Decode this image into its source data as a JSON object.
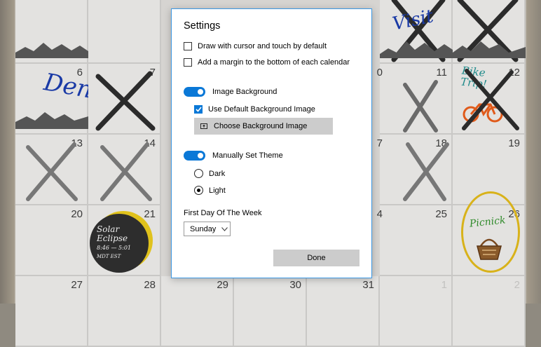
{
  "calendar": {
    "days": [
      {
        "num": "6"
      },
      {
        "num": "7"
      },
      {
        "num": "0"
      },
      {
        "num": "11"
      },
      {
        "num": "12"
      },
      {
        "num": "13"
      },
      {
        "num": "14"
      },
      {
        "num": "7"
      },
      {
        "num": "18"
      },
      {
        "num": "19"
      },
      {
        "num": "20"
      },
      {
        "num": "21"
      },
      {
        "num": "4"
      },
      {
        "num": "25"
      },
      {
        "num": "26"
      },
      {
        "num": "27"
      },
      {
        "num": "28"
      },
      {
        "num": "29"
      },
      {
        "num": "30"
      },
      {
        "num": "31"
      },
      {
        "num": "1"
      },
      {
        "num": "2"
      }
    ],
    "notes": {
      "denver": "Denver!",
      "visit": "Visit",
      "bike_trip": "Bike Trip!",
      "eclipse_line1": "Solar",
      "eclipse_line2": "Eclipse",
      "eclipse_line3": "8:46 — 5:01",
      "eclipse_line4": "MDT        EST",
      "picnic": "Picnick"
    }
  },
  "settings": {
    "title": "Settings",
    "draw_cursor_label": "Draw with cursor and touch by default",
    "draw_cursor_checked": false,
    "margin_label": "Add a margin to the bottom of each calendar",
    "margin_checked": false,
    "image_background_label": "Image Background",
    "image_background_on": true,
    "use_default_bg_label": "Use Default Background Image",
    "use_default_bg_checked": true,
    "choose_bg_label": "Choose Background Image",
    "manual_theme_label": "Manually Set Theme",
    "manual_theme_on": true,
    "theme_options": [
      {
        "label": "Dark",
        "selected": false
      },
      {
        "label": "Light",
        "selected": true
      }
    ],
    "first_day_label": "First Day Of The Week",
    "first_day_value": "Sunday",
    "done_label": "Done"
  },
  "colors": {
    "accent": "#0a78d7",
    "dialog_border": "#3b97e3",
    "button_gray": "#cccccc"
  }
}
